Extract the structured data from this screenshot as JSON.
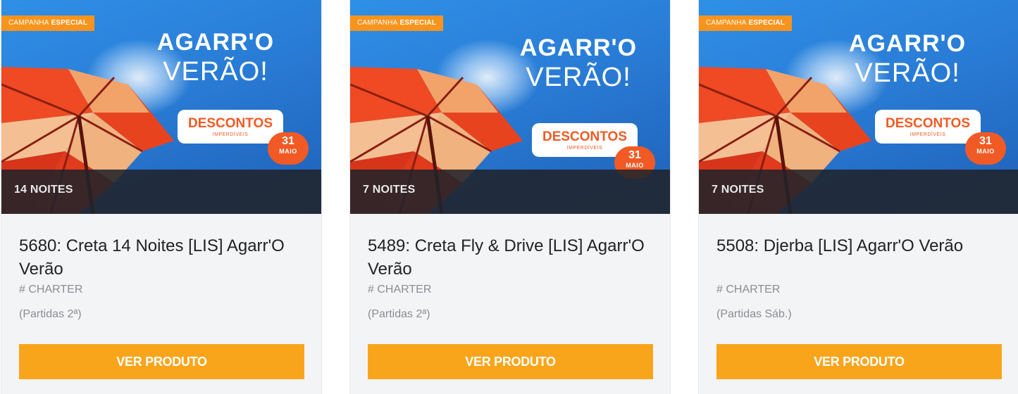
{
  "products": [
    {
      "campaign_label_pre": "CAMPANHA",
      "campaign_label_strong": "ESPECIAL",
      "headline_line1": "AGARR'O",
      "headline_line2": "VERÃO!",
      "promo_main": "DESCONTOS",
      "promo_sub": "IMPERDÍVEIS",
      "promo_day": "31",
      "promo_month": "MAIO",
      "nights": "14 NOITES",
      "title": "5680: Creta 14 Noites [LIS] Agarr'O Verão",
      "tag": "# CHARTER",
      "departures": "(Partidas 2ª)",
      "button_label": "VER PRODUTO"
    },
    {
      "campaign_label_pre": "CAMPANHA",
      "campaign_label_strong": "ESPECIAL",
      "headline_line1": "AGARR'O",
      "headline_line2": "VERÃO!",
      "promo_main": "DESCONTOS",
      "promo_sub": "IMPERDÍVEIS",
      "promo_day": "31",
      "promo_month": "MAIO",
      "nights": "7 NOITES",
      "title": "5489: Creta Fly & Drive [LIS] Agarr'O Verão",
      "tag": "# CHARTER",
      "departures": "(Partidas 2ª)",
      "button_label": "VER PRODUTO"
    },
    {
      "campaign_label_pre": "CAMPANHA",
      "campaign_label_strong": "ESPECIAL",
      "headline_line1": "AGARR'O",
      "headline_line2": "VERÃO!",
      "promo_main": "DESCONTOS",
      "promo_sub": "IMPERDÍVEIS",
      "promo_day": "31",
      "promo_month": "MAIO",
      "nights": "7 NOITES",
      "title": "5508: Djerba [LIS] Agarr'O Verão",
      "tag": "# CHARTER",
      "departures": "(Partidas Sáb.)",
      "button_label": "VER PRODUTO"
    }
  ],
  "colors": {
    "button": "#f9a51b",
    "campaign_badge": "#f7941d",
    "promo_accent": "#f15a24",
    "sky": "#2a7fd8",
    "card_bg": "#f3f4f6"
  }
}
